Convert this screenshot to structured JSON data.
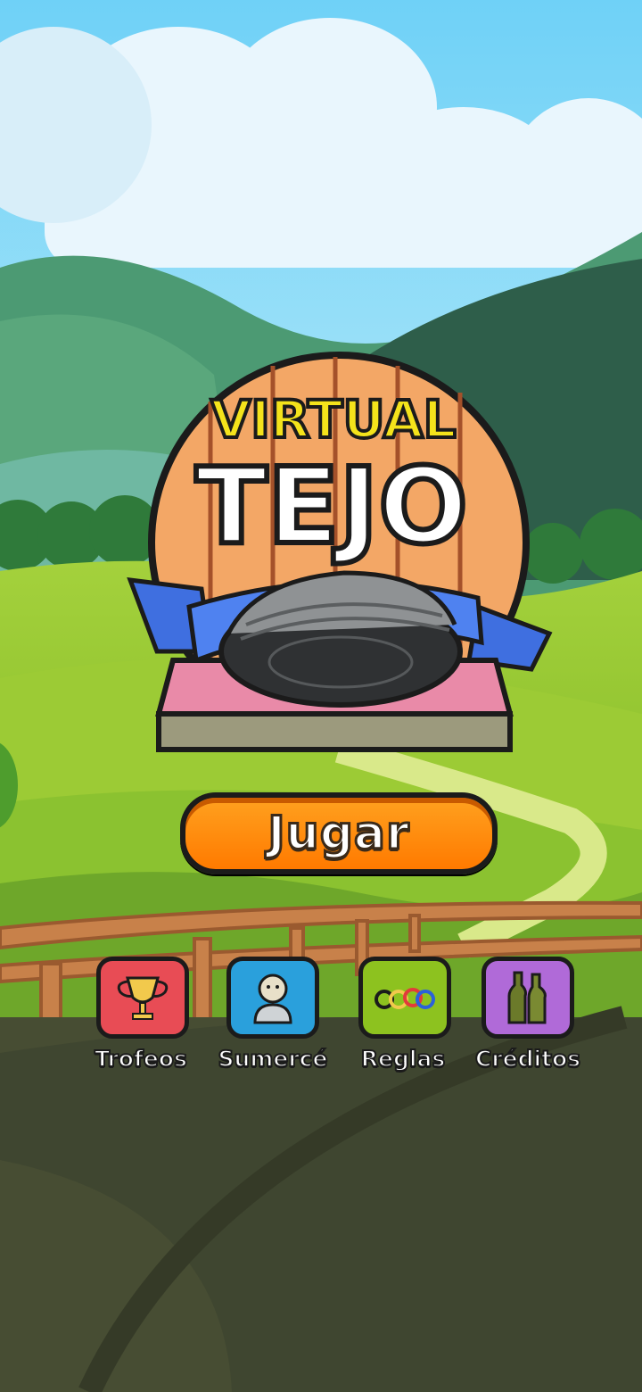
{
  "game": {
    "logo_top": "VIRTUAL",
    "logo_main": "TEJO",
    "play_label": "Jugar"
  },
  "menu": [
    {
      "label": "Trofeos",
      "icon": "trophy-icon",
      "color": "#e84c55"
    },
    {
      "label": "Sumercé",
      "icon": "profile-icon",
      "color": "#2aa0dc"
    },
    {
      "label": "Reglas",
      "icon": "rules-rings-icon",
      "color": "#8dc21f"
    },
    {
      "label": "Créditos",
      "icon": "credits-bottles-icon",
      "color": "#b06ad8"
    }
  ],
  "colors": {
    "sky": "#7fd3f5",
    "play_button": "#ff8a00",
    "road": "#474d33"
  }
}
